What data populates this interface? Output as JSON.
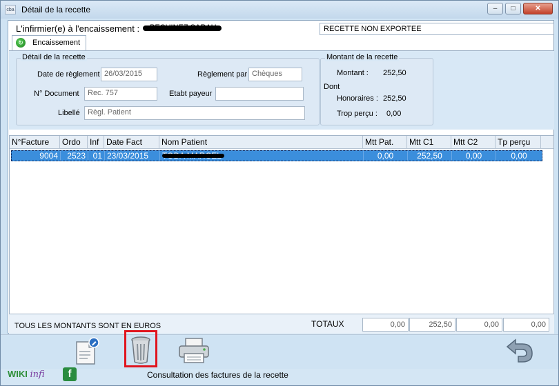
{
  "window": {
    "app_icon": "cba",
    "title": "Détail de la recette",
    "minimize": "–",
    "maximize": "□",
    "close": "✕"
  },
  "header": {
    "nurse_label": "L'infirmier(e) à l'encaissement :",
    "nurse_name": "PECHINEZ SARAH",
    "export_status": "RECETTE NON EXPORTEE"
  },
  "tab": {
    "label": "Encaissement",
    "icon": "refresh-icon"
  },
  "detail": {
    "group_title": "Détail de la recette",
    "date_label": "Date de règlement",
    "date_value": "26/03/2015",
    "reglement_label": "Règlement par",
    "reglement_value": "Chèques",
    "document_label": "N° Document",
    "document_value": "Rec. 757",
    "etabt_label": "Etabt payeur",
    "etabt_value": "",
    "libelle_label": "Libellé",
    "libelle_value": "Règl. Patient"
  },
  "montant": {
    "group_title": "Montant de la recette",
    "montant_label": "Montant :",
    "montant_value": "252,50",
    "dont_label": "Dont",
    "honoraires_label": "Honoraires :",
    "honoraires_value": "252,50",
    "trop_label": "Trop perçu :",
    "trop_value": "0,00"
  },
  "table": {
    "columns": [
      "N°Facture",
      "Ordo",
      "Inf",
      "Date Fact",
      "Nom Patient",
      "Mtt Pat.",
      "Mtt C1",
      "Mtt C2",
      "Tp perçu"
    ],
    "rows": [
      [
        "9004",
        "2523",
        "01",
        "23/03/2015",
        "TODA MARCEL",
        "0,00",
        "252,50",
        "0,00",
        "0,00"
      ]
    ]
  },
  "footer": {
    "euro_note": "TOUS LES MONTANTS SONT EN EUROS",
    "totaux_label": "TOTAUX",
    "totals": [
      "0,00",
      "252,50",
      "0,00",
      "0,00"
    ]
  },
  "toolbar": {
    "edit_icon": "edit-document-icon",
    "delete_icon": "trash-icon",
    "print_icon": "printer-icon",
    "back_icon": "back-arrow-icon"
  },
  "status": {
    "wiki_a": "WIKI",
    "wiki_b": "infi",
    "facebook": "f",
    "text": "Consultation des factures de la recette"
  },
  "colors": {
    "selection": "#3b8edc",
    "highlight_border": "#e0141e",
    "background": "#cfe3f3"
  }
}
